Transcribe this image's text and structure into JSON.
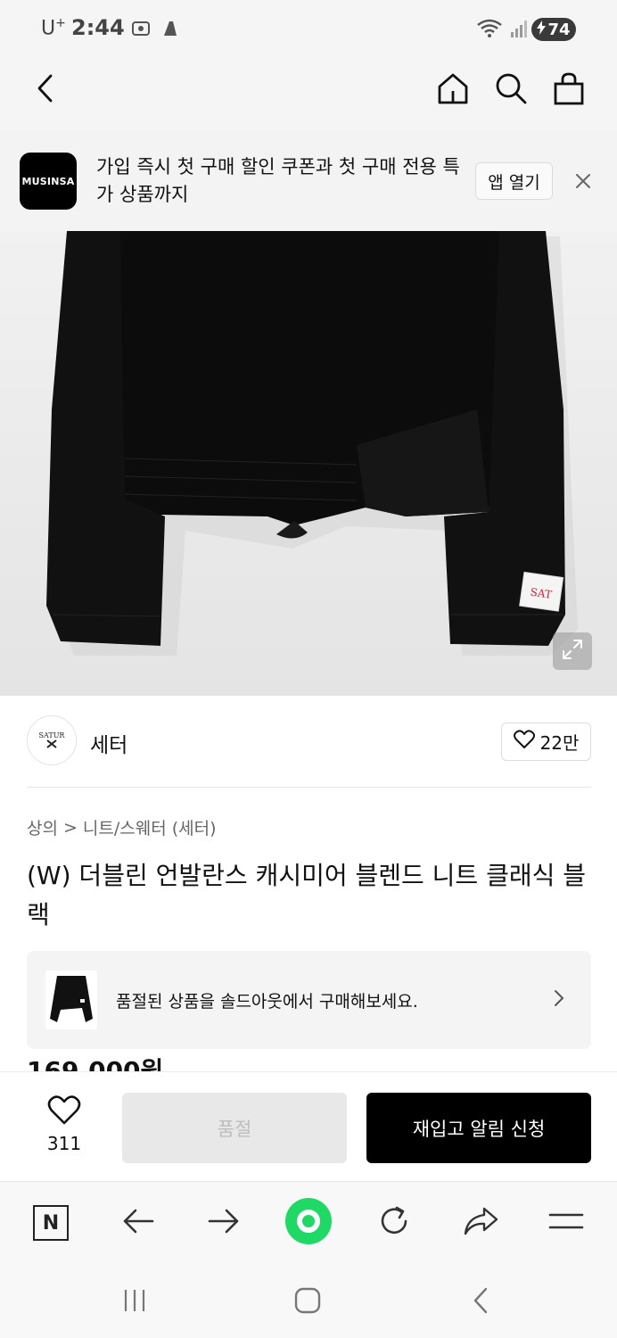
{
  "status_bar": {
    "carrier": "U",
    "carrier_sup": "+",
    "time": "2:44",
    "battery": "74"
  },
  "header": {
    "icons": [
      "back-chevron-icon",
      "home-icon",
      "search-icon",
      "shopping-bag-icon"
    ]
  },
  "banner": {
    "logo_text": "MUSINSA",
    "message": "가입 즉시 첫 구매 할인 쿠폰과 첫 구매 전용 특가 상품까지",
    "open_app_label": "앱 열기"
  },
  "product_image": {
    "label_text": "SAT"
  },
  "brand": {
    "logo_text": "SATUR",
    "name": "세터",
    "like_count": "22만"
  },
  "breadcrumb": {
    "level1": "상의",
    "separator": ">",
    "level2": "니트/스웨터 (세터)"
  },
  "product": {
    "title": "(W) 더블린 언발란스 캐시미어 블렌드 니트 클래식 블랙",
    "price_partial": "169,000원"
  },
  "soldout_card": {
    "message": "품절된 상품을 솔드아웃에서 구매해보세요."
  },
  "purchase_bar": {
    "wish_count": "311",
    "soldout_label": "품절",
    "restock_label": "재입고 알림 신청"
  },
  "browser_toolbar": {
    "n_label": "N",
    "colors": {
      "green_button": "#1ed964"
    }
  }
}
